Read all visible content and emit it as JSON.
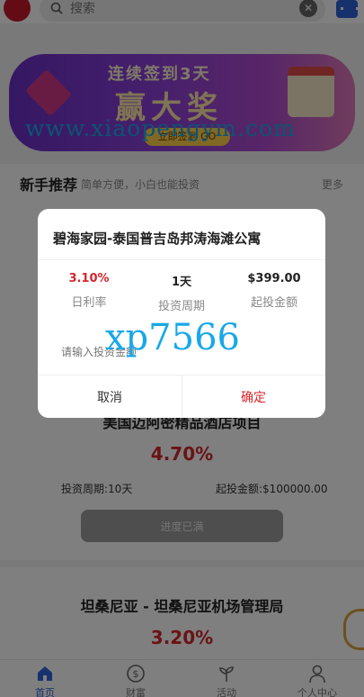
{
  "header": {
    "search_placeholder": "搜索",
    "clear_symbol": "✕"
  },
  "banner": {
    "line1": "连续签到3天",
    "line2": "赢大奖",
    "button": "立即签到 GO",
    "watermark": "www.xiaopengym.com"
  },
  "section": {
    "title": "新手推荐",
    "subtitle": "简单方便，小白也能投资",
    "more": "更多"
  },
  "products": [
    {
      "title": "美国迈阿密精品酒店项目",
      "rate": "4.70%",
      "period": "投资周期:10天",
      "min_amount": "起投金额:$100000.00",
      "button": "进度已满"
    },
    {
      "title": "坦桑尼亚 - 坦桑尼亚机场管理局",
      "rate": "3.20%"
    }
  ],
  "modal": {
    "title": "碧海家园-泰国普吉岛邦涛海滩公寓",
    "stats": [
      {
        "value": "3.10%",
        "label": "日利率"
      },
      {
        "value": "1天",
        "label": "投资周期"
      },
      {
        "value": "$399.00",
        "label": "起投金额"
      }
    ],
    "input_placeholder": "请输入投资金额",
    "watermark": "xp7566",
    "cancel": "取消",
    "confirm": "确定"
  },
  "tabbar": [
    {
      "label": "首页",
      "icon": "home-icon",
      "active": true
    },
    {
      "label": "财富",
      "icon": "wealth-icon",
      "active": false
    },
    {
      "label": "活动",
      "icon": "sprout-icon",
      "active": false
    },
    {
      "label": "个人中心",
      "icon": "user-icon",
      "active": false
    }
  ],
  "colors": {
    "accent": "#2f63d8",
    "rate_red": "#d4262c",
    "watermark": "#18a8e8"
  }
}
